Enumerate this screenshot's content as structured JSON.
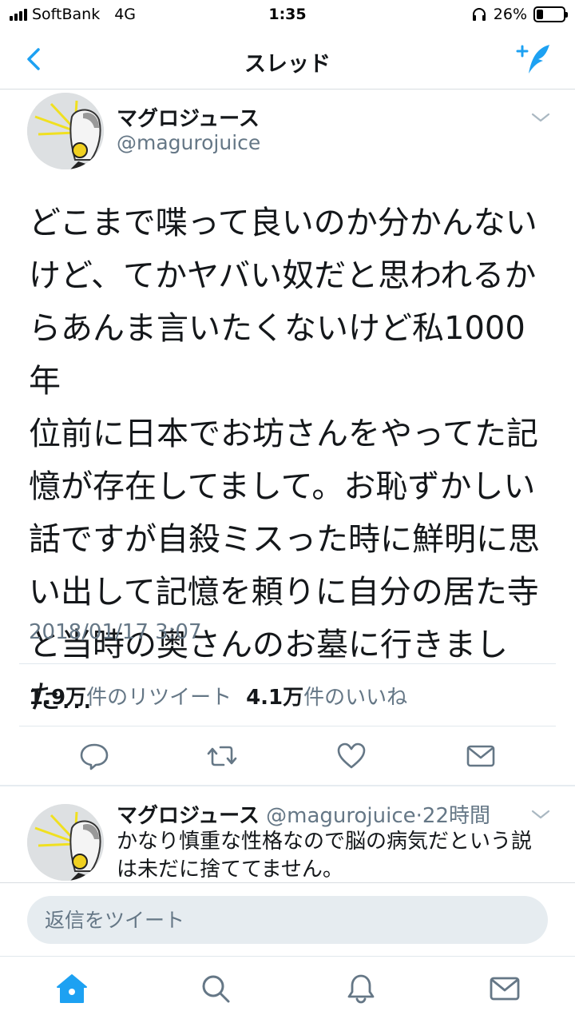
{
  "status_bar": {
    "carrier": "SoftBank",
    "network": "4G",
    "time": "1:35",
    "battery": "26%",
    "battery_level": 0.26
  },
  "nav": {
    "title": "スレッド",
    "back_icon": "chevron-left-icon",
    "compose_icon": "compose-tweet-icon",
    "accent_color": "#1da1f2"
  },
  "tweet": {
    "name": "マグロジュース",
    "handle": "@magurojuice",
    "text": "どこまで喋って良いのか分かんない\nけど、てかヤバい奴だと思われるか\nらあんま言いたくないけど私1000年\n位前に日本でお坊さんをやってた記\n憶が存在してまして。お恥ずかしい\n話ですが自殺ミスった時に鮮明に思\nい出して記憶を頼りに自分の居た寺\nと当時の奥さんのお墓に行きまし\nた…",
    "timestamp": "2018/01/17 3:07",
    "retweet_count": "1.9万",
    "retweet_label": "件のリツイート",
    "like_count": "4.1万",
    "like_label": "件のいいね"
  },
  "actions": [
    "reply-icon",
    "retweet-icon",
    "like-icon",
    "message-icon"
  ],
  "reply": {
    "name": "マグロジュース",
    "handle": "@magurojuice",
    "separator": "·",
    "time": "22時間",
    "text": "かなり慎重な性格なので脳の病気だという説は未だに捨ててません。"
  },
  "composer": {
    "placeholder": "返信をツイート"
  },
  "tab_bar": [
    "home-icon",
    "search-icon",
    "notifications-icon",
    "messages-icon"
  ]
}
